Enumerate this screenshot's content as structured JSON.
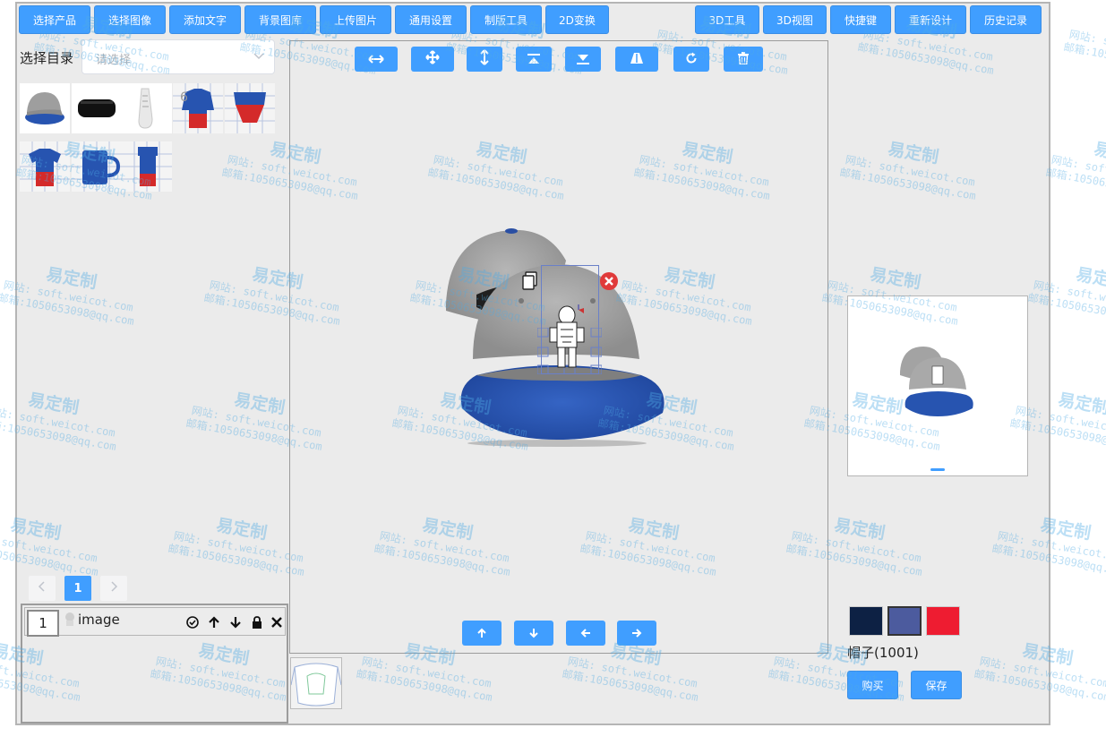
{
  "toolbar_left": [
    "选择产品",
    "选择图像",
    "添加文字",
    "背景图库",
    "上传图片",
    "通用设置",
    "制版工具",
    "2D变换"
  ],
  "toolbar_right": [
    "3D工具",
    "3D视图",
    "快捷键",
    "重新设计",
    "历史记录"
  ],
  "catalog": {
    "label": "选择目录",
    "placeholder": "请选择"
  },
  "thumbnails": [
    "cap-gray-blue",
    "black-cosmetic-bag",
    "white-sneaker",
    "red-blue-hoodie-template",
    "red-blue-shorts-template",
    "red-blue-tshirt-template",
    "blue-mug-template",
    "red-blue-tumbler-template"
  ],
  "pagination": {
    "current": "1"
  },
  "layers": [
    {
      "index": "1",
      "name": "image"
    }
  ],
  "canvas_tools": [
    "flip-horizontal-icon",
    "move-icon",
    "flip-vertical-icon",
    "align-top-icon",
    "align-bottom-icon",
    "perspective-icon",
    "rotate-icon",
    "delete-icon"
  ],
  "nudge_tools": [
    "arrow-up-icon",
    "arrow-down-icon",
    "arrow-left-icon",
    "arrow-right-icon"
  ],
  "colors": {
    "accent": "#409eff",
    "cap_blue": "#2754b0",
    "cap_gray": "#a9a9a9"
  },
  "swatches": [
    "#0d2144",
    "#4c5b9e",
    "#ee1c31"
  ],
  "product": {
    "name": "帽子(1001)"
  },
  "actions": {
    "buy": "购买",
    "save": "保存"
  },
  "watermark": {
    "brand": "易定制",
    "site": "网站: soft.weicot.com",
    "email": "邮箱:1050653098@qq.com"
  }
}
